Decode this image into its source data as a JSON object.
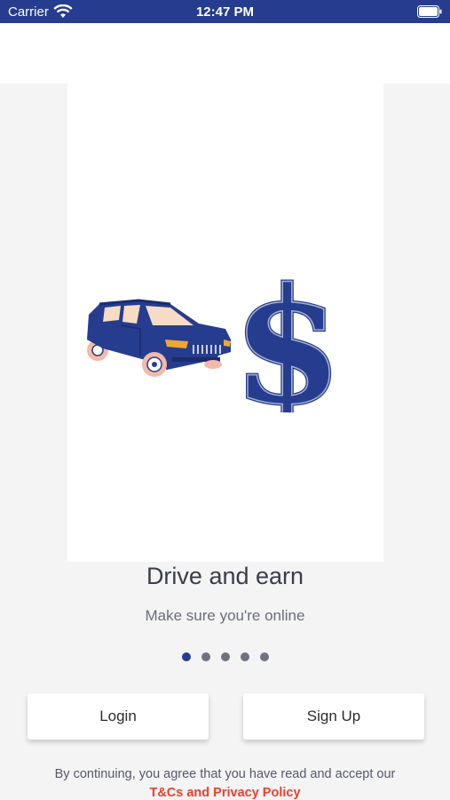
{
  "status_bar": {
    "carrier": "Carrier",
    "time": "12:47 PM",
    "wifi_icon": "wifi-icon",
    "battery_icon": "battery-icon"
  },
  "onboarding": {
    "illustration": [
      "car-icon",
      "dollar-icon"
    ],
    "title": "Drive and earn",
    "subtitle": "Make sure you're online",
    "page_count": 5,
    "active_page": 1
  },
  "actions": {
    "login_label": "Login",
    "signup_label": "Sign Up"
  },
  "legal": {
    "text": "By continuing, you agree that you have read and accept our",
    "link_label": "T&Cs and Privacy Policy"
  },
  "colors": {
    "brand": "#253c8f",
    "link": "#e8412c",
    "background": "#f4f4f5"
  }
}
